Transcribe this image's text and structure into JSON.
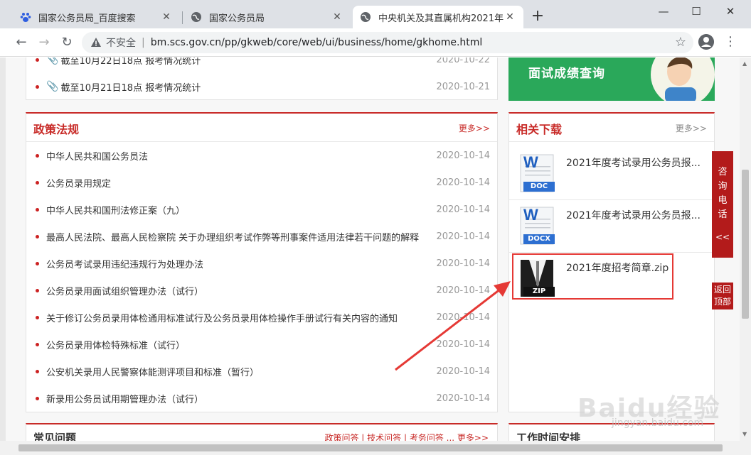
{
  "browser": {
    "tabs": [
      {
        "title": "国家公务员局_百度搜索",
        "active": false
      },
      {
        "title": "国家公务员局",
        "active": false
      },
      {
        "title": "中央机关及其直属机构2021年度",
        "active": true
      }
    ],
    "new_tab": "+",
    "window_controls": {
      "minimize": "—",
      "maximize": "☐",
      "close": "✕"
    },
    "insecure_label": "不安全",
    "separator": "|",
    "url": "bm.scs.gov.cn/pp/gkweb/core/web/ui/business/home/gkhome.html"
  },
  "news_top": [
    {
      "text": "截至10月22日18点 报考情况统计",
      "date": "2020-10-22"
    },
    {
      "text": "截至10月21日18点 报考情况统计",
      "date": "2020-10-21"
    }
  ],
  "banner": {
    "text": "面试成绩查询"
  },
  "policy": {
    "title": "政策法规",
    "more": "更多>>",
    "items": [
      {
        "text": "中华人民共和国公务员法",
        "date": "2020-10-14"
      },
      {
        "text": "公务员录用规定",
        "date": "2020-10-14"
      },
      {
        "text": "中华人民共和国刑法修正案（九）",
        "date": "2020-10-14"
      },
      {
        "text": "最高人民法院、最高人民检察院 关于办理组织考试作弊等刑事案件适用法律若干问题的解释",
        "date": "2020-10-14"
      },
      {
        "text": "公务员考试录用违纪违规行为处理办法",
        "date": "2020-10-14"
      },
      {
        "text": "公务员录用面试组织管理办法（试行）",
        "date": "2020-10-14"
      },
      {
        "text": "关于修订公务员录用体检通用标准试行及公务员录用体检操作手册试行有关内容的通知",
        "date": "2020-10-14"
      },
      {
        "text": "公务员录用体检特殊标准（试行）",
        "date": "2020-10-14"
      },
      {
        "text": "公安机关录用人民警察体能测评项目和标准（暂行）",
        "date": "2020-10-14"
      },
      {
        "text": "新录用公务员试用期管理办法（试行）",
        "date": "2020-10-14"
      }
    ]
  },
  "downloads": {
    "title": "相关下载",
    "more": "更多>>",
    "items": [
      {
        "name": "2021年度考试录用公务员报...",
        "type": "DOC"
      },
      {
        "name": "2021年度考试录用公务员报...",
        "type": "DOCX"
      },
      {
        "name": "2021年度招考简章.zip",
        "type": "ZIP"
      }
    ]
  },
  "side": {
    "consult_chars": [
      "咨",
      "询",
      "电",
      "话"
    ],
    "collapse": "<<",
    "back_top": [
      "返回",
      "顶部"
    ]
  },
  "bottom": {
    "faq_title": "常见问题",
    "faq_links": "政策问答 | 技术问答 | 考务问答 ... 更多>>",
    "work_title": "工作时间安排"
  },
  "watermark": {
    "main": "Baidu经验",
    "sub": "jingyan.baidu.com"
  },
  "colors": {
    "accent": "#c82b28",
    "banner": "#2aa85a",
    "highlight": "#e53935"
  }
}
